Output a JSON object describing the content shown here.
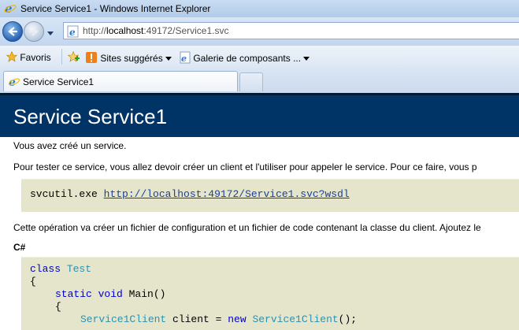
{
  "window": {
    "title": "Service Service1 - Windows Internet Explorer"
  },
  "address_bar": {
    "url_prefix": "http://",
    "url_host": "localhost",
    "url_rest": ":49172/Service1.svc"
  },
  "favorites_bar": {
    "favorites_label": "Favoris",
    "items": [
      {
        "label": "Sites suggérés",
        "icon": "suggested-sites-icon"
      },
      {
        "label": "Galerie de composants ...",
        "icon": "ie-page-icon"
      }
    ]
  },
  "tabs": [
    {
      "label": "Service Service1"
    }
  ],
  "page": {
    "heading": "Service Service1",
    "intro": "Vous avez créé un service.",
    "test_text": "Pour tester ce service, vous allez devoir créer un client et l'utiliser pour appeler le service. Pour ce faire, vous p",
    "command": "svcutil.exe",
    "wsdl_link": "http://localhost:49172/Service1.svc?wsdl",
    "operation_text": "Cette opération va créer un fichier de configuration et un fichier de code contenant la classe du client. Ajoutez le",
    "lang_label": "C#",
    "code": {
      "line1_kw": "class",
      "line1_type": "Test",
      "line2": "{",
      "line3_kw": "static void",
      "line3_rest": " Main()",
      "line4": "{",
      "line5_type1": "Service1Client",
      "line5_mid": " client = ",
      "line5_kw": "new",
      "line5_type2": "Service1Client",
      "line5_end": "();"
    }
  },
  "colors": {
    "header_band": "#003366",
    "code_bg": "#e5e5cc",
    "link": "#1a3f9a"
  }
}
